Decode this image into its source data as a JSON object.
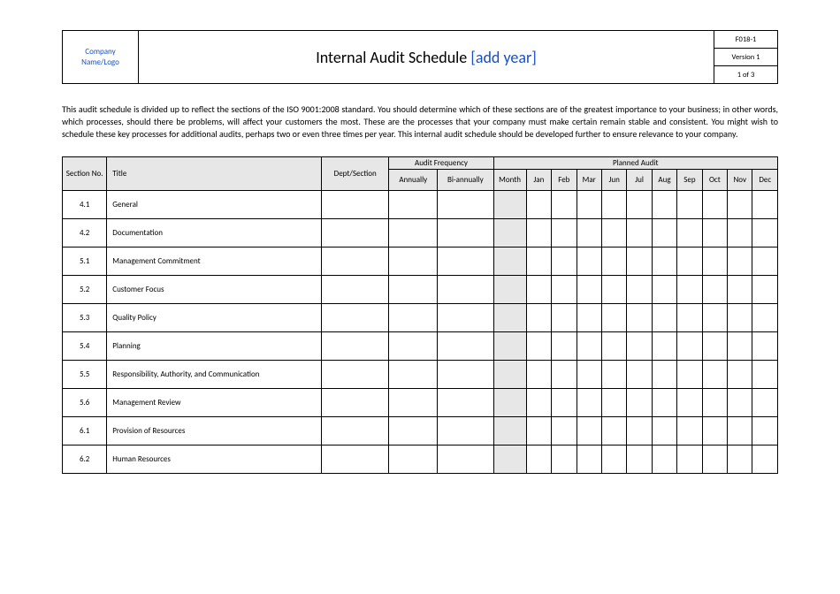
{
  "header": {
    "logo_line1": "Company",
    "logo_line2": "Name/Logo",
    "title_main": "Internal Audit Schedule ",
    "title_year": "[add year]",
    "form_code": "F018-1",
    "version": "Version 1",
    "page_of": "1 of 3"
  },
  "intro": "This audit schedule is divided up to reflect the sections of the ISO 9001:2008 standard. You should determine which of these sections are of the greatest importance to your business; in other words, which processes, should there be problems, will affect your customers the most. These are the processes that your company must make certain remain stable and consistent. You might wish to schedule these key processes for additional audits, perhaps two or even three times per year. This internal audit schedule should be developed further to ensure relevance to your company.",
  "table": {
    "head": {
      "section_no": "Section No.",
      "title": "Title",
      "dept": "Dept/Section",
      "freq": "Audit Frequency",
      "planned": "Planned Audit",
      "annually": "Annually",
      "biannually": "Bi-annually",
      "month": "Month",
      "months": [
        "Jan",
        "Feb",
        "Mar",
        "Jun",
        "Jul",
        "Aug",
        "Sep",
        "Oct",
        "Nov",
        "Dec"
      ]
    },
    "rows": [
      {
        "sec": "4.1",
        "title": "General"
      },
      {
        "sec": "4.2",
        "title": "Documentation"
      },
      {
        "sec": "5.1",
        "title": "Management Commitment"
      },
      {
        "sec": "5.2",
        "title": "Customer Focus"
      },
      {
        "sec": "5.3",
        "title": "Quality Policy"
      },
      {
        "sec": "5.4",
        "title": "Planning"
      },
      {
        "sec": "5.5",
        "title": "Responsibility, Authority, and Communication"
      },
      {
        "sec": "5.6",
        "title": "Management Review"
      },
      {
        "sec": "6.1",
        "title": "Provision of Resources"
      },
      {
        "sec": "6.2",
        "title": "Human Resources"
      }
    ]
  }
}
